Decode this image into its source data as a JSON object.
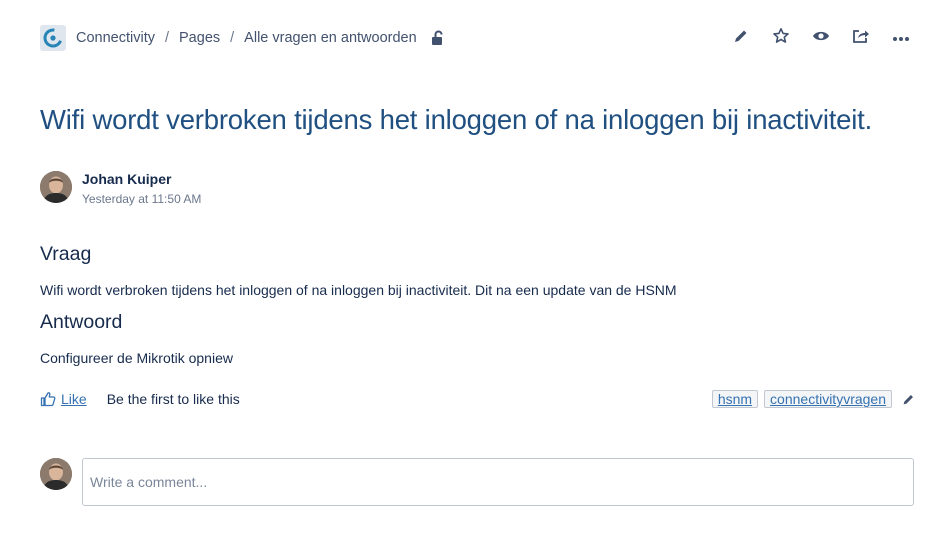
{
  "breadcrumb": {
    "space": "Connectivity",
    "sep": "/",
    "pages": "Pages",
    "current": "Alle vragen en antwoorden"
  },
  "actions": {
    "edit": "pencil-icon",
    "favourite": "star-icon",
    "watch": "eye-icon",
    "share": "share-icon",
    "more": "more-icon"
  },
  "page": {
    "title": "Wifi wordt verbroken tijdens het inloggen of na inloggen bij inactiviteit."
  },
  "byline": {
    "author": "Johan Kuiper",
    "timestamp": "Yesterday at 11:50 AM"
  },
  "content": {
    "question_heading": "Vraag",
    "question_text": "Wifi wordt verbroken tijdens het inloggen of na inloggen bij inactiviteit. Dit na een update van de HSNM",
    "answer_heading": "Antwoord",
    "answer_text": "Configureer de Mikrotik opniew"
  },
  "likes": {
    "like_label": "Like",
    "summary": "Be the first to like this"
  },
  "labels": [
    "hsnm",
    "connectivityvragen"
  ],
  "comment": {
    "placeholder": "Write a comment..."
  },
  "colors": {
    "title": "#205081",
    "link": "#3572b0",
    "text": "#172b4d",
    "muted": "#6b778c"
  }
}
